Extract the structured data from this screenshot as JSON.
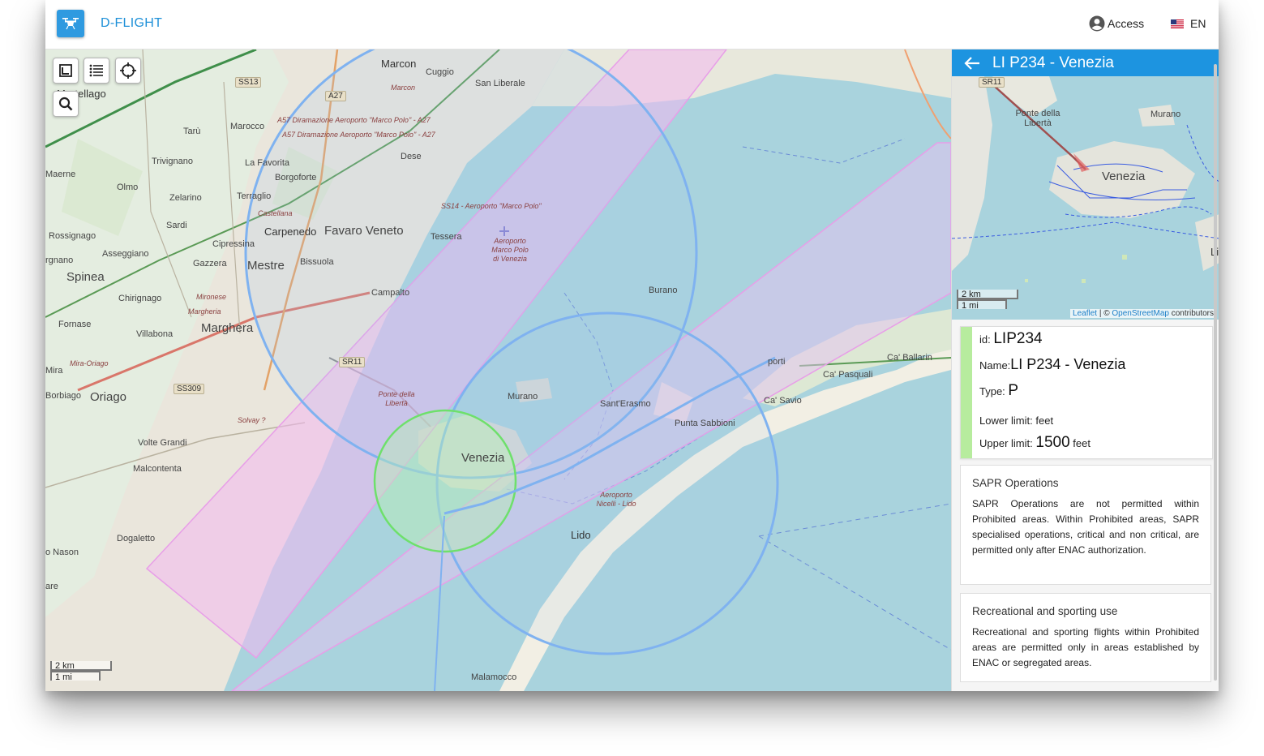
{
  "app": {
    "title": "D-FLIGHT"
  },
  "header": {
    "access_label": "Access",
    "language": "EN"
  },
  "colors": {
    "brand": "#1d94e0",
    "prohibited_area": "#b7ec9e",
    "zone_pink": "#f2b8f0",
    "zone_blue": "#7fb2f0",
    "zone_green": "#6ee06b"
  },
  "map": {
    "controls": [
      "layers-icon",
      "list-icon",
      "locate-icon",
      "search-icon"
    ],
    "scale": {
      "km": "2 km",
      "mi": "1 mi"
    },
    "labels": {
      "marcon": "Marcon",
      "cuggio": "Cuggio",
      "san_liberale": "San Liberale",
      "martellago": "Martellago",
      "ss13": "SS13",
      "a27": "A27",
      "marocco": "Marocco",
      "taru": "Tarù",
      "trivignano": "Trivignano",
      "maerne": "Maerne",
      "olmo": "Olmo",
      "zelarino": "Zelarino",
      "sardi": "Sardi",
      "rossignago": "Rossignago",
      "asseggiano": "Asseggiano",
      "spinea": "Spinea",
      "gazzera": "Gazzera",
      "chirignago": "Chirignago",
      "fornase": "Fornase",
      "villabona": "Villabona",
      "marghera": "Marghera",
      "mira_oriago_road": "Mira-Oriago",
      "borbiago": "Borbiago",
      "oriago": "Oriago",
      "ss309": "SS309",
      "solvay": "Solvay ?",
      "volte_grandi": "Volte Grandi",
      "malcontenta": "Malcontenta",
      "dogaletto": "Dogaletto",
      "o_nason": "o Nason",
      "are": "are",
      "mira": "Mira",
      "ignano": "rgnano",
      "mestre": "Mestre",
      "favaro": "Favaro Veneto",
      "carpenedo": "Carpenedo",
      "bissuola": "Bissuola",
      "campalto": "Campalto",
      "tessera": "Tessera",
      "dese": "Dese",
      "la_favorita": "La Favorita",
      "borgoforte": "Borgoforte",
      "terraglio": "Terraglio",
      "castellana": "Castellana",
      "cipressina": "Cipressina",
      "mironese": "Mironese",
      "margheria": "Margheria",
      "sr11": "SR11",
      "ponte_liberta": "Ponte della Libertà",
      "venezia": "Venezia",
      "murano": "Murano",
      "burano": "Burano",
      "santerasmo": "Sant'Erasmo",
      "punta_sabbioni": "Punta Sabbioni",
      "lido": "Lido",
      "malamocco": "Malamocco",
      "ca_savio": "Ca' Savio",
      "ca_pasquali": "Ca' Pasquali",
      "ca_ballarin": "Ca' Ballarin",
      "porti": "porti",
      "aeroporto_nicelli": "Aeroporto Nicelli - Lido",
      "aeroporto_marco_polo": "Aeroporto Marco Polo di Venezia",
      "a57_1": "A57 Diramazione Aeroporto \"Marco Polo\" - A27",
      "a57_2": "A57 Diramazione Aeroporto \"Marco Polo\" - A27",
      "ss14": "SS14 - Aeroporto \"Marco Polo\"",
      "marcon_it": "Marcon",
      "sa14": "SS14"
    }
  },
  "panel": {
    "title": "LI P234 - Venezia",
    "minimap": {
      "labels": {
        "sr11": "SR11",
        "ponte": "Ponte della Libertà",
        "murano": "Murano",
        "venezia": "Venezia",
        "li": "Li"
      },
      "scale": {
        "km": "2 km",
        "mi": "1 mi"
      },
      "attribution": {
        "leaflet": "Leaflet",
        "sep": " | © ",
        "osm": "OpenStreetMap",
        "contributors": " contributors"
      }
    },
    "info": {
      "id_label": "id:",
      "id_value": "LIP234",
      "name_label": "Name:",
      "name_value": "LI P234 - Venezia",
      "type_label": "Type:",
      "type_value": "P",
      "lower_label": "Lower limit:",
      "lower_value": "",
      "lower_unit": "feet",
      "upper_label": "Upper limit:",
      "upper_value": "1500",
      "upper_unit": "feet"
    },
    "rules": [
      {
        "title": "SAPR Operations",
        "text": "SAPR Operations are not permitted within Prohibited areas. Within Prohibited areas, SAPR specialised operations, critical and non critical, are permitted only after ENAC authorization."
      },
      {
        "title": "Recreational and sporting use",
        "text": "Recreational and sporting flights within Prohibited areas are permitted only in areas established by ENAC or segregated areas."
      }
    ]
  }
}
